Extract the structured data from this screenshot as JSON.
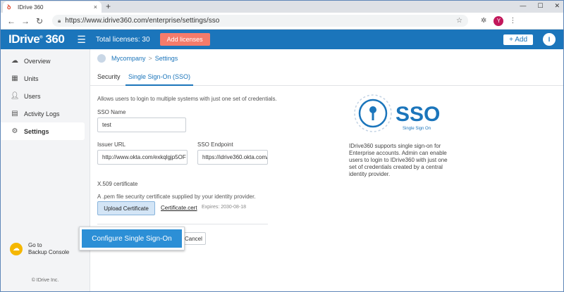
{
  "browser": {
    "tab_title": "IDrive 360",
    "tab_close": "×",
    "new_tab": "+",
    "url": "https://www.idrive360.com/enterprise/settings/sso",
    "profile_initial": "Y"
  },
  "header": {
    "logo": "IDrive",
    "logo_suffix": "360",
    "total_licenses": "Total licenses: 30",
    "add_licenses_label": "Add licenses",
    "add_label": "+ Add",
    "user_initial": "I"
  },
  "sidebar": {
    "items": [
      {
        "label": "Overview",
        "icon": "cloud-icon"
      },
      {
        "label": "Units",
        "icon": "units-icon"
      },
      {
        "label": "Users",
        "icon": "user-icon"
      },
      {
        "label": "Activity Logs",
        "icon": "log-icon"
      },
      {
        "label": "Settings",
        "icon": "gear-icon",
        "active": true
      }
    ],
    "backup_line1": "Go to",
    "backup_line2": "Backup Console",
    "copyright": "© IDrive Inc."
  },
  "breadcrumb": {
    "org": "Mycompany",
    "separator": ">",
    "page": "Settings"
  },
  "tabs": [
    {
      "label": "Security",
      "active": false
    },
    {
      "label": "Single Sign-On (SSO)",
      "active": true
    }
  ],
  "form": {
    "description": "Allows users to login to multiple systems with just one set of credentials.",
    "sso_name_label": "SSO Name",
    "sso_name_value": "test",
    "issuer_url_label": "Issuer URL",
    "issuer_url_value": "http://www.okta.com/exkqlgjp5OF",
    "sso_endpoint_label": "SSO Endpoint",
    "sso_endpoint_value": "https://idrive360.okta.com/app/idr",
    "cert_label": "X.509 certificate",
    "cert_desc": "A .pem file security certificate supplied by your identity provider.",
    "upload_label": "Upload Certificate",
    "cert_file": "Certificate.cert",
    "expires": "Expires: 2030-08-18",
    "configure_label": "Configure Single Sign-On",
    "cancel_label": "Cancel"
  },
  "sso_info": {
    "big": "SSO",
    "small": "Single Sign On",
    "text": "IDrive360 supports single sign-on for Enterprise accounts. Admin can enable users to login to IDrive360 with just one set of credentials created by a central identity provider."
  },
  "colors": {
    "brand": "#1b75bb",
    "add_licenses": "#f47b6b",
    "configure": "#2c8fd6"
  }
}
